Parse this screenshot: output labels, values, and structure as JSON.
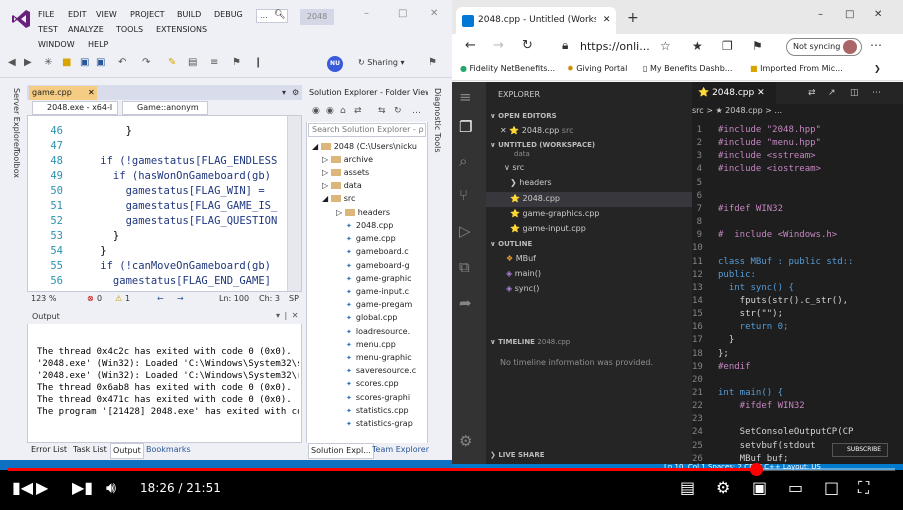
{
  "visual_studio": {
    "menu": [
      "FILE",
      "EDIT",
      "VIEW",
      "PROJECT",
      "BUILD",
      "DEBUG",
      "TEST",
      "ANALYZE",
      "TOOLS",
      "EXTENSIONS",
      "WINDOW",
      "HELP"
    ],
    "search_placeholder": "...",
    "solution_name": "2048",
    "user_initials": "NU",
    "sharing_label": "Sharing",
    "side_tabs": [
      "Server Explorer",
      "Toolbox"
    ],
    "diag_tab": "Diagnostic Tools",
    "editor": {
      "tab": "game.cpp",
      "tab_dirty": "✕",
      "nav_project": "2048.exe - x64-l",
      "nav_scope": "Game::anonym",
      "lines": [
        {
          "n": "46",
          "text": "        }"
        },
        {
          "n": "47",
          "text": ""
        },
        {
          "n": "48",
          "text": "    if (!gamestatus[FLAG_ENDLESS"
        },
        {
          "n": "49",
          "text": "      if (hasWonOnGameboard(gb)"
        },
        {
          "n": "50",
          "text": "        gamestatus[FLAG_WIN] = "
        },
        {
          "n": "51",
          "text": "        gamestatus[FLAG_GAME_IS_"
        },
        {
          "n": "52",
          "text": "        gamestatus[FLAG_QUESTION"
        },
        {
          "n": "53",
          "text": "      }"
        },
        {
          "n": "54",
          "text": "    }"
        },
        {
          "n": "55",
          "text": "    if (!canMoveOnGameboard(gb)"
        },
        {
          "n": "56",
          "text": "      gamestatus[FLAG_END_GAME]"
        }
      ],
      "status": {
        "zoom": "123 %",
        "errors": "0",
        "warnings": "1",
        "line": "Ln: 100",
        "col": "Ch: 3",
        "mode": "SP"
      }
    },
    "output": {
      "title": "Output",
      "lines": [
        "The thread 0x4c2c has exited with code 0 (0x0).",
        "'2048.exe' (Win32): Loaded 'C:\\Windows\\System32\\s",
        "'2048.exe' (Win32): Loaded 'C:\\Windows\\System32\\r",
        "The thread 0x6ab8 has exited with code 0 (0x0).",
        "The thread 0x471c has exited with code 0 (0x0).",
        "The program '[21428] 2048.exe' has exited with co"
      ],
      "bottom_tabs": [
        "Error List",
        "Task List",
        "Output",
        "Bookmarks"
      ]
    },
    "solution_explorer": {
      "title": "Solution Explorer - Folder View",
      "search_placeholder": "Search Solution Explorer - ρ",
      "root": "2048 (C:\\Users\\nicku",
      "folders": [
        "archive",
        "assets",
        "data",
        "src"
      ],
      "headers_folder": "headers",
      "files": [
        "2048.cpp",
        "game.cpp",
        "gameboard.c",
        "gameboard-g",
        "game-graphic",
        "game-input.c",
        "game-pregam",
        "global.cpp",
        "loadresource.",
        "menu.cpp",
        "menu-graphic",
        "saveresource.c",
        "scores.cpp",
        "scores-graphi",
        "statistics.cpp",
        "statistics-grap"
      ],
      "bottom_tabs": [
        "Solution Expl...",
        "Team Explorer"
      ]
    }
  },
  "browser": {
    "tab_title": "2048.cpp - Untitled (Workspace)",
    "url": "https://onli...",
    "sync_label": "Not syncing",
    "bookmarks": [
      "Fidelity NetBenefits...",
      "Giving Portal",
      "My Benefits Dashb...",
      "Imported From Mic..."
    ],
    "vscode": {
      "explorer_label": "EXPLORER",
      "open_editors_label": "OPEN EDITORS",
      "open_editor_item": "2048.cpp",
      "open_editor_path": "src",
      "workspace_label": "UNTITLED (WORKSPACE)",
      "tree": [
        "data",
        "src",
        "headers",
        "2048.cpp",
        "game-graphics.cpp",
        "game-input.cpp"
      ],
      "outline_label": "OUTLINE",
      "outline": [
        "MBuf",
        "main()",
        "sync()"
      ],
      "timeline_label": "TIMELINE",
      "timeline_file": "2048.cpp",
      "timeline_empty": "No timeline information was provided.",
      "live_share_label": "LIVE SHARE",
      "editor_tab": "2048.cpp",
      "breadcrumb": "src > ★ 2048.cpp > ...",
      "lines": [
        {
          "n": "1",
          "t": "#include \"2048.hpp\""
        },
        {
          "n": "2",
          "t": "#include \"menu.hpp\""
        },
        {
          "n": "3",
          "t": "#include <sstream>"
        },
        {
          "n": "4",
          "t": "#include <iostream>"
        },
        {
          "n": "5",
          "t": ""
        },
        {
          "n": "6",
          "t": ""
        },
        {
          "n": "7",
          "t": "#ifdef WIN32"
        },
        {
          "n": "8",
          "t": ""
        },
        {
          "n": "9",
          "t": "#  include <Windows.h>"
        },
        {
          "n": "10",
          "t": ""
        },
        {
          "n": "11",
          "t": "class MBuf : public std::"
        },
        {
          "n": "12",
          "t": "public:"
        },
        {
          "n": "13",
          "t": "  int sync() {"
        },
        {
          "n": "14",
          "t": "    fputs(str().c_str(),"
        },
        {
          "n": "15",
          "t": "    str(\"\");"
        },
        {
          "n": "16",
          "t": "    return 0;"
        },
        {
          "n": "17",
          "t": "  }"
        },
        {
          "n": "18",
          "t": "};"
        },
        {
          "n": "19",
          "t": "#endif"
        },
        {
          "n": "20",
          "t": ""
        },
        {
          "n": "21",
          "t": "int main() {"
        },
        {
          "n": "22",
          "t": "    #ifdef WIN32"
        },
        {
          "n": "23",
          "t": ""
        },
        {
          "n": "24",
          "t": "    SetConsoleOutputCP(CP"
        },
        {
          "n": "25",
          "t": "    setvbuf(stdout"
        },
        {
          "n": "26",
          "t": "    MBuf buf;"
        }
      ],
      "status": "Ln 10, Col 1   Spaces: 2   CRLF   C++   Layout: US"
    }
  },
  "player": {
    "current_time": "18:26",
    "duration": "21:51",
    "time_display": "18:26 / 21:51",
    "progress": 0.843,
    "subscribe_label": "SUBSCRIBE",
    "colors": {
      "progress": "#ff0000",
      "vs_accent": "#0e70c0",
      "vscode_status": "#007acc"
    }
  }
}
